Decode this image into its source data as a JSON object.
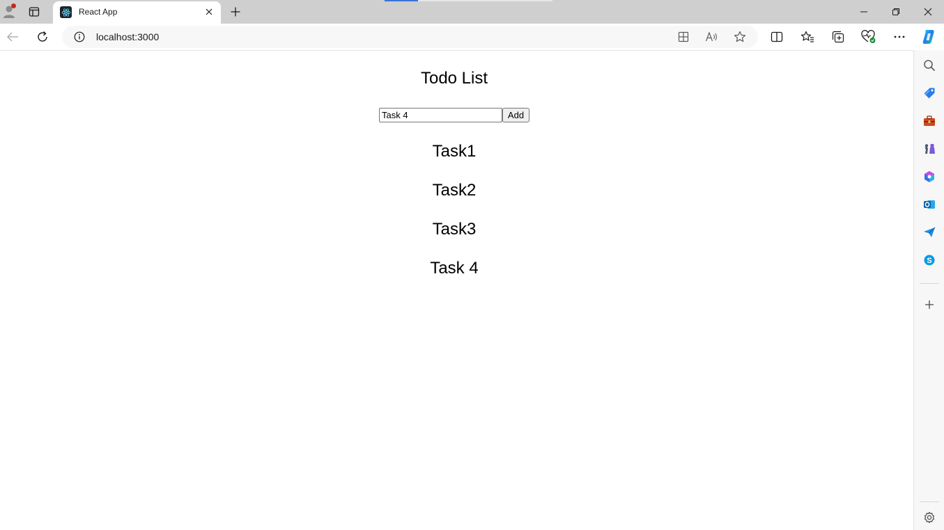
{
  "browser": {
    "tab": {
      "title": "React App"
    },
    "address_bar": {
      "url": "localhost:3000"
    },
    "accent_color": "#3b72d6"
  },
  "app": {
    "title": "Todo List",
    "input_value": "Task 4",
    "add_button_label": "Add",
    "todos": [
      "Task1",
      "Task2",
      "Task3",
      "Task 4"
    ]
  },
  "icons": {
    "profile": "profile-icon",
    "tab_actions": "tab-actions-icon",
    "react_logo": "react-logo-icon",
    "close": "close-icon",
    "new_tab": "plus-icon",
    "back": "back-arrow-icon",
    "refresh": "refresh-icon",
    "info": "info-icon",
    "sidebar_tools": [
      "search-icon",
      "shopping-tag-icon",
      "toolbox-icon",
      "games-icon",
      "microsoft365-icon",
      "outlook-icon",
      "send-icon",
      "skype-icon",
      "plus-icon",
      "gear-icon"
    ]
  }
}
